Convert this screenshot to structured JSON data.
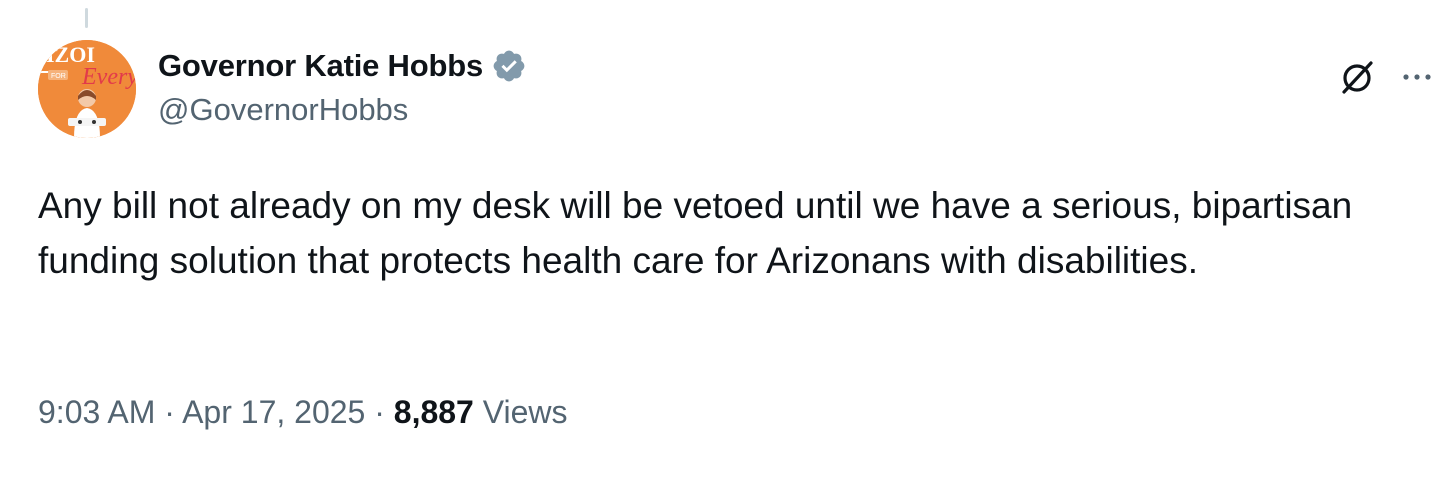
{
  "author": {
    "display_name": "Governor Katie Hobbs",
    "handle": "@GovernorHobbs",
    "verified_badge": "verified-badge-icon",
    "avatar_text": "IZONA FOR Everyone"
  },
  "tweet": {
    "text": "Any bill not already on my desk will be vetoed until we have a serious, bipartisan funding solution that protects health care for Arizonans with disabilities.",
    "time": "9:03 AM",
    "separator": "·",
    "date": "Apr 17, 2025",
    "views_count": "8,887",
    "views_label": "Views"
  },
  "actions": {
    "grok_icon": "grok-icon",
    "more_icon": "more-dots-icon"
  },
  "colors": {
    "text": "#0f1419",
    "secondary": "#536471",
    "verified": "#829aab",
    "avatar_bg": "#f08a3a"
  }
}
